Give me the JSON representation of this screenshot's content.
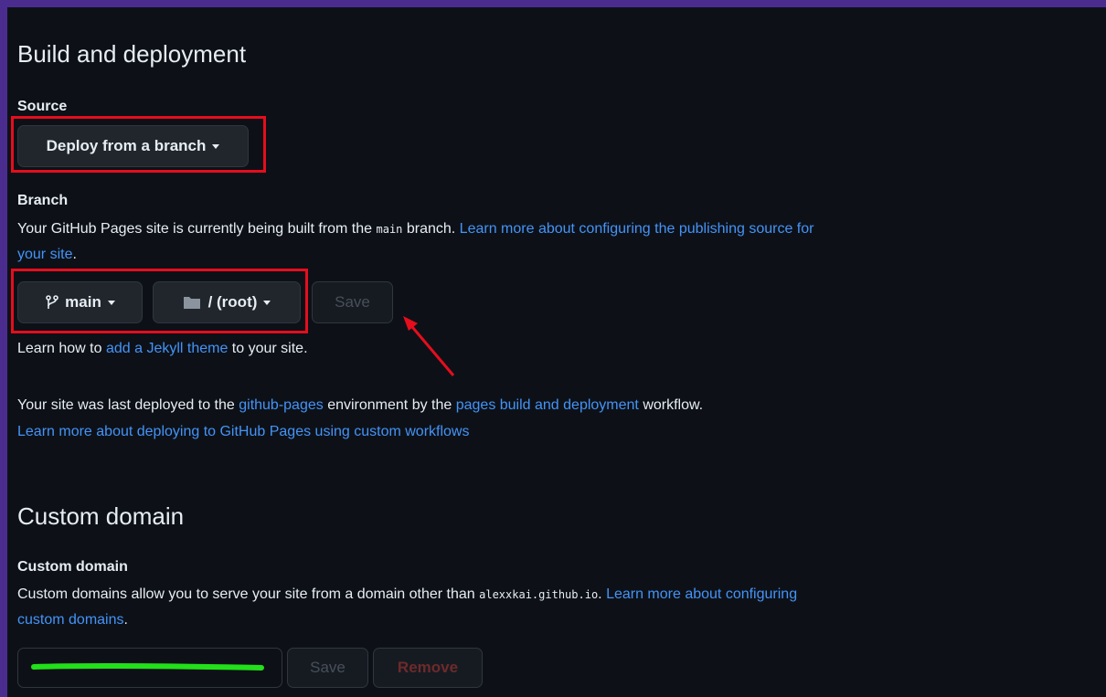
{
  "build_section": {
    "title": "Build and deployment",
    "source_label": "Source",
    "source_dropdown": "Deploy from a branch",
    "branch_label": "Branch",
    "branch_desc_prefix": "Your GitHub Pages site is currently being built from the ",
    "branch_desc_code": "main",
    "branch_desc_suffix": " branch. ",
    "branch_desc_link_1": "Learn more about configuring the publishing source for",
    "branch_desc_link_2": "your site",
    "branch_desc_end": ".",
    "branch_button": "main",
    "folder_button": "/ (root)",
    "save_button": "Save",
    "jekyll_prefix": "Learn how to ",
    "jekyll_link": "add a Jekyll theme",
    "jekyll_suffix": " to your site.",
    "deploy_prefix": "Your site was last deployed to the ",
    "deploy_env_link": "github-pages",
    "deploy_mid": " environment by the ",
    "deploy_workflow_link": "pages build and deployment",
    "deploy_suffix": " workflow.",
    "custom_workflows_link": "Learn more about deploying to GitHub Pages using custom workflows"
  },
  "custom_domain_section": {
    "title": "Custom domain",
    "label": "Custom domain",
    "desc_prefix": "Custom domains allow you to serve your site from a domain other than ",
    "desc_code": "alexxkai.github.io",
    "desc_mid": ". ",
    "desc_link_1": "Learn more about configuring",
    "desc_link_2": "custom domains",
    "desc_end": ".",
    "save_button": "Save",
    "remove_button": "Remove"
  },
  "icons": {
    "branch": "git-branch-icon",
    "folder": "folder-icon",
    "caret": "caret-down-icon"
  },
  "colors": {
    "background": "#0d1117",
    "frame": "#4a2c8f",
    "link": "#4493f8",
    "annotation_red": "#e60d1d",
    "redaction_green": "#22e01a"
  }
}
